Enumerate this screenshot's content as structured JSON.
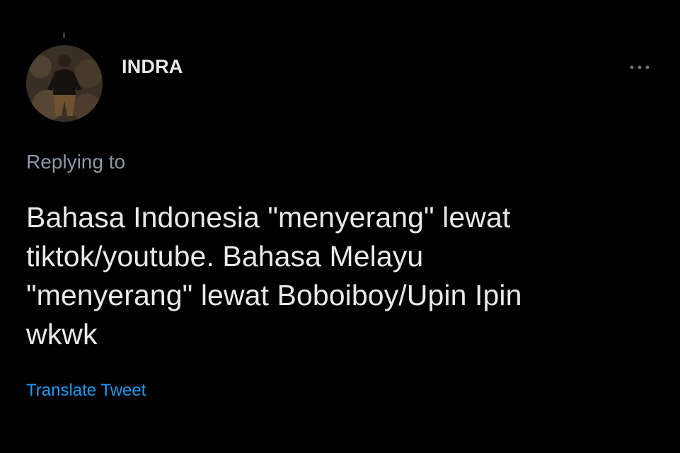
{
  "tweet": {
    "author": {
      "display_name": "INDRA",
      "avatar_icon": "user-photo-avatar"
    },
    "more_icon": "more-horizontal-icon",
    "reply_label": "Replying to",
    "text": "Bahasa Indonesia \"menyerang\" lewat\ntiktok/youtube. Bahasa Melayu\n\"menyerang\" lewat Boboiboy/Upin Ipin\nwkwk",
    "translate_label": "Translate Tweet"
  },
  "colors": {
    "background": "#000000",
    "primary_text": "#e7e9ea",
    "secondary_text": "#8b98a5",
    "link": "#1d9bf0"
  }
}
